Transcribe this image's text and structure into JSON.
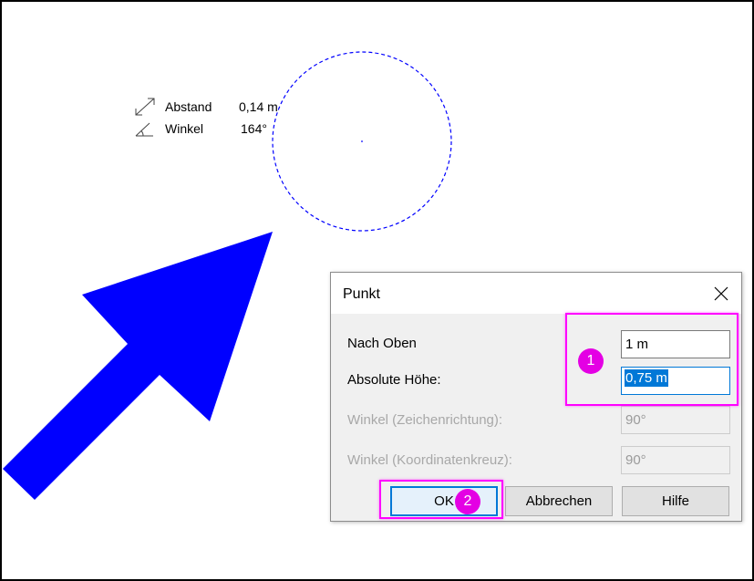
{
  "readout": {
    "distance": {
      "label": "Abstand",
      "value": "0,14 m"
    },
    "angle": {
      "label": "Winkel",
      "value": "164°"
    }
  },
  "dialog": {
    "title": "Punkt",
    "fields": [
      {
        "label": "Nach Oben",
        "value": "1 m",
        "enabled": true
      },
      {
        "label": "Absolute Höhe:",
        "value": "0,75 m",
        "enabled": true,
        "focused": true
      },
      {
        "label": "Winkel (Zeichenrichtung):",
        "value": "90°",
        "enabled": false
      },
      {
        "label": "Winkel (Koordinatenkreuz):",
        "value": "90°",
        "enabled": false
      }
    ],
    "buttons": {
      "ok": "OK",
      "cancel": "Abbrechen",
      "help": "Hilfe"
    }
  },
  "annotations": {
    "badge_1": "1",
    "badge_2": "2"
  },
  "colors": {
    "arrow": "#0000ff",
    "circle_outline": "#0000ff",
    "highlight": "#ff00ff",
    "badge": "#e400e4",
    "selection": "#0078d7"
  },
  "icons": {
    "distance": "diagonal-double-arrow-icon",
    "angle": "angle-icon",
    "close": "close-x-icon"
  }
}
